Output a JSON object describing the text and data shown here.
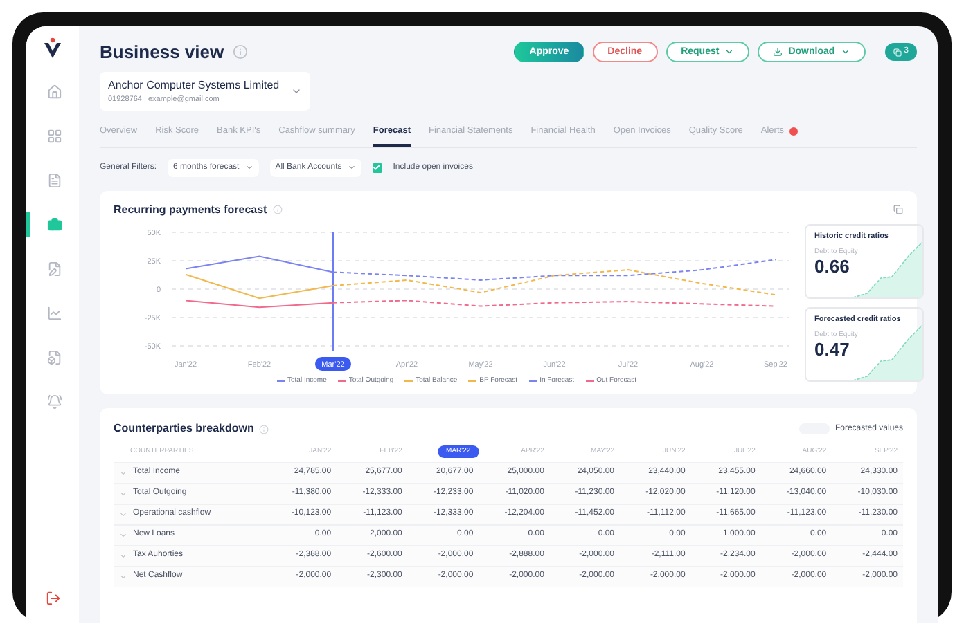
{
  "sidebar": {
    "items": [
      {
        "selected": false
      },
      {
        "selected": false
      },
      {
        "selected": false
      },
      {
        "selected": true
      },
      {
        "selected": false
      },
      {
        "selected": false
      },
      {
        "selected": false
      },
      {
        "selected": false
      }
    ]
  },
  "header": {
    "title": "Business view",
    "company": {
      "name": "Anchor Computer Systems Limited",
      "details": "01928764 | example@gmail.com"
    },
    "buttons": [
      {
        "label": "Approve",
        "kind": "primary"
      },
      {
        "label": "Decline",
        "kind": "danger"
      },
      {
        "label": "Request",
        "kind": "menu"
      },
      {
        "label": "Download",
        "kind": "download"
      }
    ],
    "badge": "3"
  },
  "tabs": [
    {
      "label": "Overview",
      "selected": false
    },
    {
      "label": "Risk Score",
      "selected": false
    },
    {
      "label": "Bank KPI's",
      "selected": false
    },
    {
      "label": "Cashflow summary",
      "selected": false
    },
    {
      "label": "Forecast",
      "selected": true
    },
    {
      "label": "Financial Statements",
      "selected": false
    },
    {
      "label": "Financial Health",
      "selected": false
    },
    {
      "label": "Open Invoices",
      "selected": false
    },
    {
      "label": "Quality Score",
      "selected": false
    },
    {
      "label": "Alerts",
      "selected": false,
      "alert": true
    }
  ],
  "filters": {
    "label": "General Filters:",
    "period": "6 months forecast",
    "accounts": "All Bank Accounts",
    "include_open_invoices": {
      "label": "Include open invoices",
      "checked": true
    }
  },
  "forecast": {
    "title": "Recurring payments forecast",
    "chart_data": {
      "type": "line",
      "categories": [
        "Jan'22",
        "Feb'22",
        "Mar'22",
        "Apr'22",
        "May'22",
        "Jun'22",
        "Jul'22",
        "Aug'22",
        "Sep'22"
      ],
      "ylim": [
        -50000,
        50000
      ],
      "yticks": [
        {
          "value": 50000,
          "label": "50K"
        },
        {
          "value": 25000,
          "label": "25K"
        },
        {
          "value": 0,
          "label": "0"
        },
        {
          "value": -25000,
          "label": "-25K"
        },
        {
          "value": -50000,
          "label": "-50K"
        }
      ],
      "grid": true,
      "ref_lines": [
        {
          "axis": "x",
          "value": "Mar'22",
          "color": "#6b7cf5"
        }
      ],
      "series": [
        {
          "name": "Total Income",
          "color": "#7b83f0",
          "line_style": "solid",
          "values": [
            18000,
            29000,
            15000,
            null,
            null,
            null,
            null,
            null,
            null
          ]
        },
        {
          "name": "Total Outgoing",
          "color": "#f06a8c",
          "line_style": "solid",
          "values": [
            -10000,
            -16000,
            -12000,
            null,
            null,
            null,
            null,
            null,
            null
          ]
        },
        {
          "name": "Total Balance",
          "color": "#f2b84b",
          "line_style": "solid",
          "values": [
            13000,
            -8000,
            3000,
            null,
            null,
            null,
            null,
            null,
            null
          ]
        },
        {
          "name": "BP Forecast",
          "color": "#f2b84b",
          "line_style": "dashed",
          "values": [
            null,
            null,
            3000,
            8000,
            -3000,
            12000,
            17000,
            5000,
            -5000
          ]
        },
        {
          "name": "In Forecast",
          "color": "#7b83f0",
          "line_style": "dashed",
          "values": [
            null,
            null,
            15000,
            12000,
            8000,
            12000,
            12000,
            17000,
            26000
          ]
        },
        {
          "name": "Out Forecast",
          "color": "#f06a8c",
          "line_style": "dashed",
          "values": [
            null,
            null,
            -12000,
            -10000,
            -15000,
            -12000,
            -11000,
            -13000,
            -15000
          ]
        }
      ]
    },
    "ratios": [
      {
        "title": "Historic credit ratios",
        "label": "Debt to Equity",
        "value": "0.66"
      },
      {
        "title": "Forecasted credit ratios",
        "label": "Debt to Equity",
        "value": "0.47"
      }
    ]
  },
  "breakdown": {
    "title": "Counterparties breakdown",
    "legend": "Forecasted values",
    "columns": [
      {
        "label": "COUNTERPARTIES",
        "selected": false
      },
      {
        "label": "JAN'22",
        "selected": false
      },
      {
        "label": "FEB'22",
        "selected": false
      },
      {
        "label": "MAR'22",
        "selected": true
      },
      {
        "label": "APR'22",
        "selected": false
      },
      {
        "label": "MAY'22",
        "selected": false
      },
      {
        "label": "JUN'22",
        "selected": false
      },
      {
        "label": "JUL'22",
        "selected": false
      },
      {
        "label": "AUG'22",
        "selected": false
      },
      {
        "label": "SEP'22",
        "selected": false
      }
    ],
    "rows": [
      [
        "Total Income",
        "24,785.00",
        "25,677.00",
        "20,677.00",
        "25,000.00",
        "24,050.00",
        "23,440.00",
        "23,455.00",
        "24,660.00",
        "24,330.00"
      ],
      [
        "Total Outgoing",
        "-11,380.00",
        "-12,333.00",
        "-12,233.00",
        "-11,020.00",
        "-11,230.00",
        "-12,020.00",
        "-11,120.00",
        "-13,040.00",
        "-10,030.00"
      ],
      [
        "Operational cashflow",
        "-10,123.00",
        "-11,123.00",
        "-12,333.00",
        "-12,204.00",
        "-11,452.00",
        "-11,112.00",
        "-11,665.00",
        "-11,123.00",
        "-11,230.00"
      ],
      [
        "New Loans",
        "0.00",
        "2,000.00",
        "0.00",
        "0.00",
        "0.00",
        "0.00",
        "1,000.00",
        "0.00",
        "0.00"
      ],
      [
        "Tax Auhorties",
        "-2,388.00",
        "-2,600.00",
        "-2,000.00",
        "-2,888.00",
        "-2,000.00",
        "-2,111.00",
        "-2,234.00",
        "-2,000.00",
        "-2,444.00"
      ],
      [
        "Net Cashflow",
        "-2,000.00",
        "-2,300.00",
        "-2,000.00",
        "-2,000.00",
        "-2,000.00",
        "-2,000.00",
        "-2,000.00",
        "-2,000.00",
        "-2,000.00"
      ]
    ]
  }
}
